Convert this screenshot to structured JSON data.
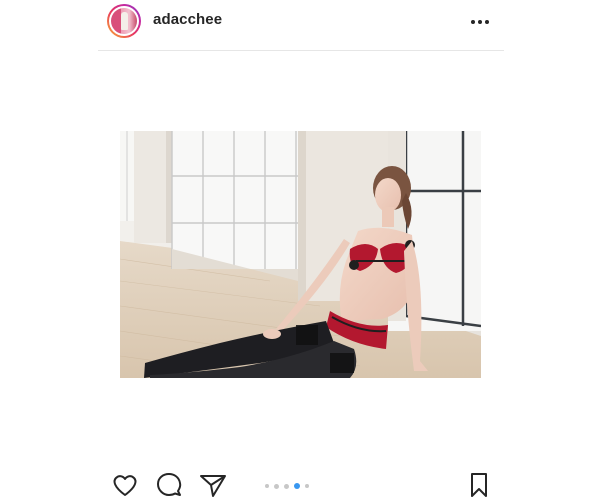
{
  "post": {
    "username": "adacchee",
    "carousel": {
      "total": 5,
      "active_index": 3
    },
    "colors": {
      "accent": "#3897f0",
      "dot_inactive": "#c7c7c7",
      "divider": "#e6e6e6",
      "text": "#262626"
    },
    "icons": {
      "more": "more-options-icon",
      "like": "heart-icon",
      "comment": "comment-bubble-icon",
      "share": "paper-plane-icon",
      "save": "bookmark-icon"
    }
  }
}
